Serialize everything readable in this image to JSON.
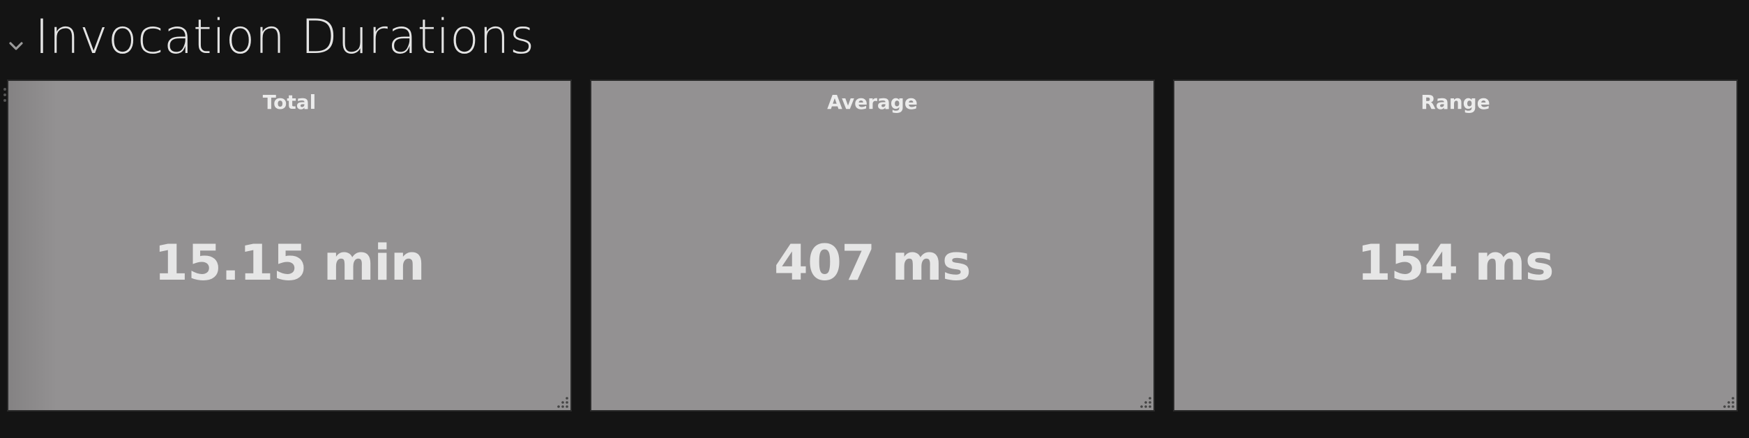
{
  "row": {
    "title": "Invocation Durations",
    "collapse_icon": "chevron-down-icon"
  },
  "panels": [
    {
      "title": "Total",
      "value": "15.15 min"
    },
    {
      "title": "Average",
      "value": "407 ms"
    },
    {
      "title": "Range",
      "value": "154 ms"
    }
  ],
  "colors": {
    "background": "#141414",
    "panel_background": "#939192",
    "text": "#e6e6e6",
    "handle": "#444444"
  }
}
